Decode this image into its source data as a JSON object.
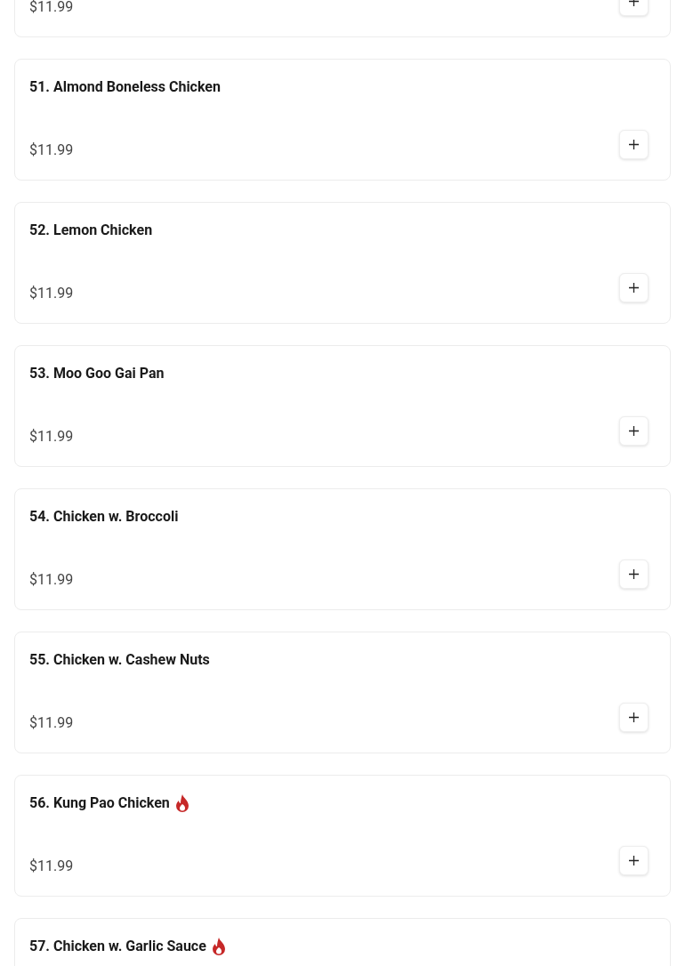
{
  "menu_items": [
    {
      "price": "$11.99"
    },
    {
      "name": "51. Almond Boneless Chicken",
      "spicy": false,
      "price": "$11.99"
    },
    {
      "name": "52. Lemon Chicken",
      "spicy": false,
      "price": "$11.99"
    },
    {
      "name": "53. Moo Goo Gai Pan",
      "spicy": false,
      "price": "$11.99"
    },
    {
      "name": "54. Chicken w. Broccoli",
      "spicy": false,
      "price": "$11.99"
    },
    {
      "name": "55. Chicken w. Cashew Nuts",
      "spicy": false,
      "price": "$11.99"
    },
    {
      "name": "56. Kung Pao Chicken",
      "spicy": true,
      "price": "$11.99"
    },
    {
      "name": "57. Chicken w. Garlic Sauce",
      "spicy": true
    }
  ]
}
